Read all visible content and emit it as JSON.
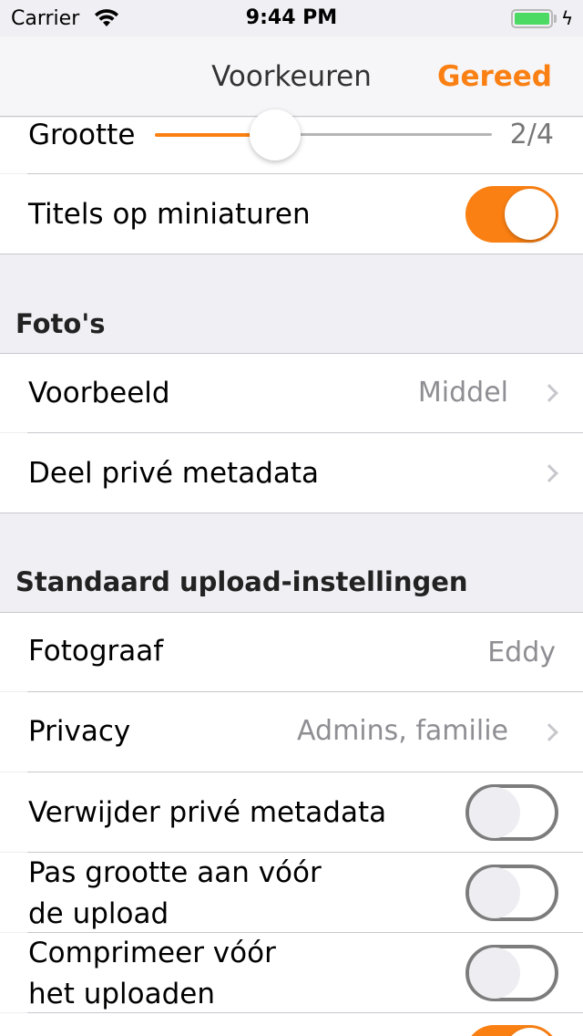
{
  "status_bar": {
    "carrier": "Carrier",
    "time": "9:44 PM",
    "battery_level": 1.0
  },
  "nav": {
    "title": "Voorkeuren",
    "done_label": "Gereed"
  },
  "appearance": {
    "size": {
      "label": "Grootte",
      "value_text": "2/4",
      "fraction": 0.33
    },
    "titles_on_thumbnails": {
      "label": "Titels op miniaturen",
      "on": true
    }
  },
  "photos": {
    "header": "Foto's",
    "preview": {
      "label": "Voorbeeld",
      "value": "Middel"
    },
    "share_private_metadata": {
      "label": "Deel privé metadata"
    }
  },
  "upload": {
    "header": "Standaard upload-instellingen",
    "photographer": {
      "label": "Fotograaf",
      "value": "Eddy"
    },
    "privacy": {
      "label": "Privacy",
      "value": "Admins, familie"
    },
    "remove_private_metadata": {
      "label": "Verwijder privé metadata",
      "on": false
    },
    "resize_before_upload": {
      "label_line1": "Pas grootte aan vóór",
      "label_line2": "de upload",
      "on": false
    },
    "compress_before_upload": {
      "label_line1": "Comprimeer vóór",
      "label_line2": "het uploaden",
      "on": false
    },
    "next_toggle": {
      "on": true
    }
  },
  "colors": {
    "accent": "#fa8013",
    "battery": "#4cd964",
    "background": "#efeff4"
  }
}
